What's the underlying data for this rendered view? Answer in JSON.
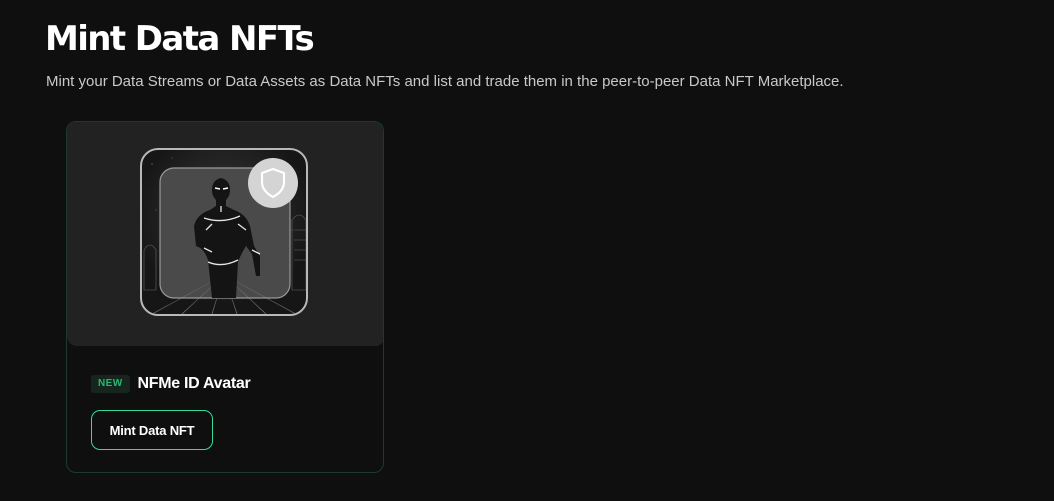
{
  "header": {
    "title": "Mint Data NFTs",
    "subtitle": "Mint your Data Streams or Data Assets as Data NFTs and list and trade them in the peer-to-peer Data NFT Marketplace."
  },
  "cards": [
    {
      "badge": "NEW",
      "title": "NFMe ID Avatar",
      "button_label": "Mint Data NFT",
      "image_icon": "avatar-figure",
      "badge_icon": "shield-icon"
    }
  ],
  "colors": {
    "background": "#0f0f0f",
    "card_border": "#1c3b2e",
    "accent": "#35d99a",
    "new_badge_text": "#2bb673"
  }
}
